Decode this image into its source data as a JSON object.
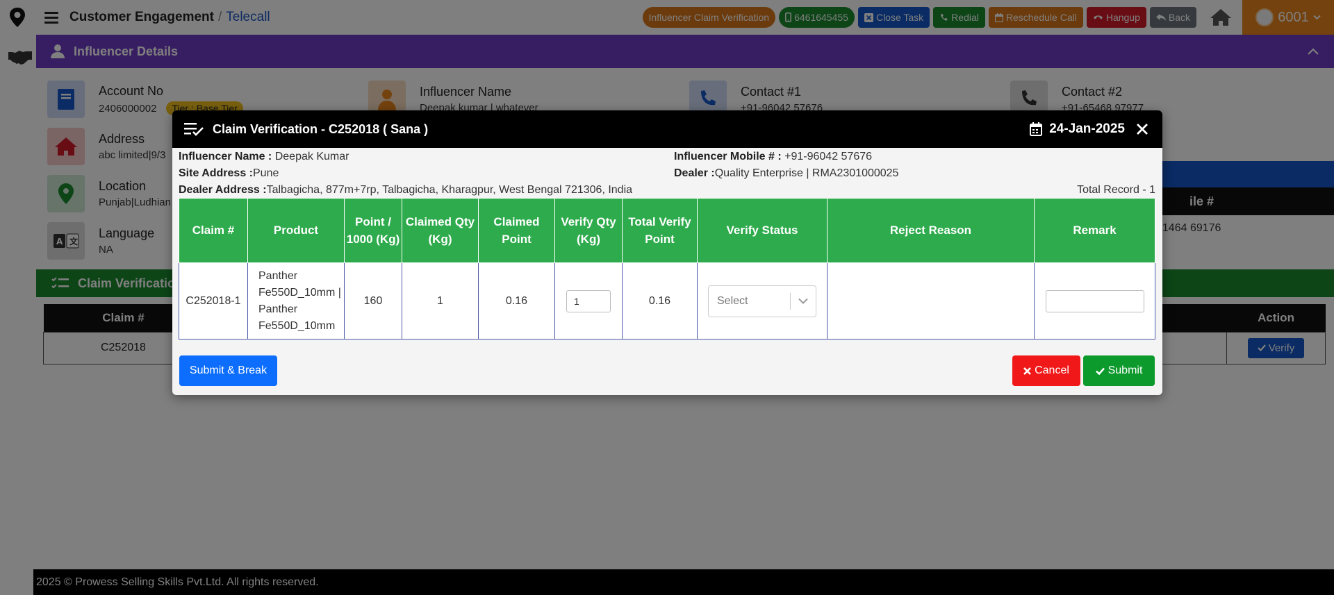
{
  "app": {
    "module_title": "Customer Engagement",
    "separator": "/",
    "sub_page": "Telecall"
  },
  "top_actions": {
    "claim_verification": "Influencer Claim Verification",
    "phone": "6461645455",
    "close_task": "Close Task",
    "redial": "Redial",
    "reschedule": "Reschedule Call",
    "hangup": "Hangup",
    "back": "Back",
    "user_id": "6001"
  },
  "influencer_section": {
    "title": "Influencer Details",
    "account_label": "Account No",
    "account_value": "2406000002",
    "tier": "Tier : Base Tier",
    "name_label": "Influencer Name",
    "name_value": "Deepak kumar | whatever",
    "contact1_label": "Contact #1",
    "contact1_value": "+91-96042 57676",
    "contact2_label": "Contact #2",
    "contact2_value": "+91-65468 97977",
    "address_label": "Address",
    "address_value": "abc limited|9/3",
    "location_label": "Location",
    "location_value": "Punjab|Ludhian",
    "language_label": "Language",
    "language_value": "NA",
    "mobile_header_fragment": "ile #",
    "mobile_value_fragment": "91464 69176"
  },
  "claim_section": {
    "title": "Claim Verification",
    "col_claim": "Claim #",
    "col_action": "Action",
    "row_claim": "C252018",
    "verify_label": "Verify"
  },
  "modal": {
    "title": "Claim Verification - C252018 ( Sana )",
    "date": "24-Jan-2025",
    "influencer_name_label": "Influencer Name :",
    "influencer_name": "Deepak Kumar",
    "site_address_label": "Site Address :",
    "site_address": "Pune",
    "dealer_address_label": "Dealer Address :",
    "dealer_address": "Talbagicha, 877m+7rp, Talbagicha, Kharagpur, West Bengal 721306, India",
    "mobile_label": "Influencer Mobile # :",
    "mobile": "+91-96042 57676",
    "dealer_label": "Dealer :",
    "dealer": "Quality Enterprise | RMA2301000025",
    "total_record": "Total Record - 1",
    "headers": {
      "claim": "Claim #",
      "product": "Product",
      "point_per": "Point / 1000 (Kg)",
      "claimed_qty": "Claimed Qty (Kg)",
      "claimed_point": "Claimed Point",
      "verify_qty": "Verify Qty (Kg)",
      "total_verify_point": "Total Verify Point",
      "verify_status": "Verify Status",
      "reject_reason": "Reject Reason",
      "remark": "Remark"
    },
    "row": {
      "claim": "C252018-1",
      "product": "Panther Fe550D_10mm | Panther Fe550D_10mm",
      "point_per": "160",
      "claimed_qty": "1",
      "claimed_point": "0.16",
      "verify_qty": "1",
      "total_verify_point": "0.16",
      "verify_status_placeholder": "Select",
      "reject_reason": "",
      "remark": ""
    },
    "buttons": {
      "submit_break": "Submit & Break",
      "cancel": "Cancel",
      "submit": "Submit"
    }
  },
  "footer": {
    "copyright": "2025 © Prowess Selling Skills Pvt.Ltd. All rights reserved."
  },
  "colors": {
    "purple_header": "#6f3ac4",
    "green_header": "#2eab4c",
    "orange": "#e8841c",
    "blue": "#0d6efd",
    "red": "#f01818",
    "submit_green": "#0c9a2c"
  }
}
